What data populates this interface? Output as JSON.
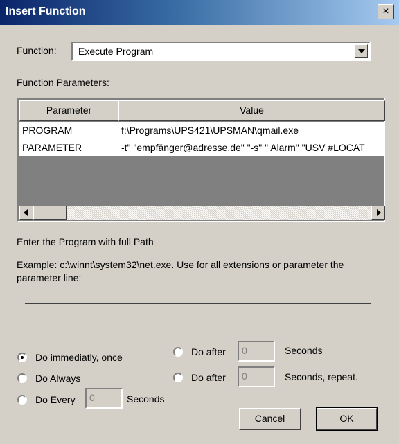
{
  "window": {
    "title": "Insert Function",
    "close_glyph": "×"
  },
  "function": {
    "label": "Function:",
    "selected": "Execute Program"
  },
  "parameters": {
    "label": "Function Parameters:",
    "headers": [
      "Parameter",
      "Value"
    ],
    "rows": [
      {
        "name": "PROGRAM",
        "value": "f:\\Programs\\UPS421\\UPSMAN\\qmail.exe"
      },
      {
        "name": "PARAMETER",
        "value": "-t\" \"empfänger@adresse.de\" \"-s\" \" Alarm\" \"USV #LOCAT"
      }
    ]
  },
  "help": {
    "line1": "Enter the Program with full Path",
    "line2": "Example: c:\\winnt\\system32\\net.exe. Use for all extensions or parameter the",
    "line3": "parameter line:"
  },
  "options": {
    "immediately": "Do immediatly, once",
    "always": "Do Always",
    "every": "Do Every",
    "every_value": "0",
    "every_unit": "Seconds",
    "after1": "Do after",
    "after1_value": "0",
    "after1_unit": "Seconds",
    "after2": "Do after",
    "after2_value": "0",
    "after2_unit": "Seconds, repeat."
  },
  "buttons": {
    "cancel": "Cancel",
    "ok": "OK"
  }
}
